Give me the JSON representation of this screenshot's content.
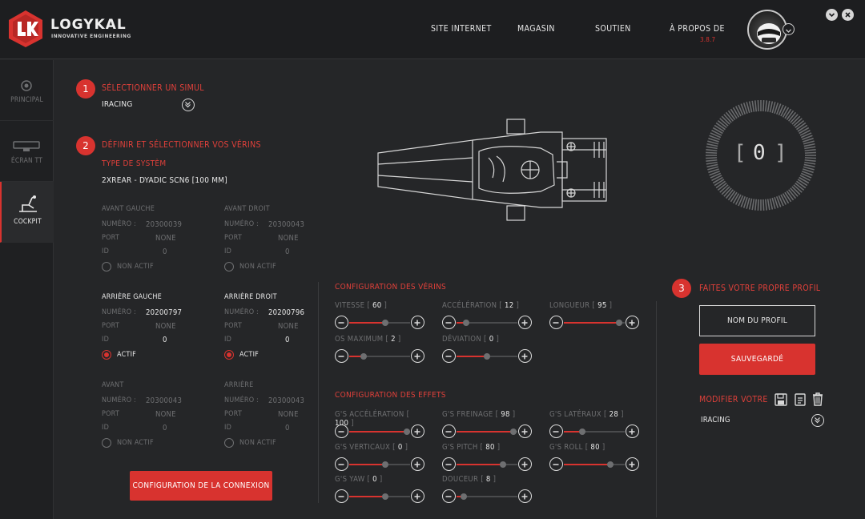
{
  "header": {
    "brand": "LOGYKAL",
    "tagline": "INNOVATIVE ENGINEERING",
    "nav": [
      "SITE INTERNET",
      "MAGASIN",
      "SOUTIEN",
      "À PROPOS DE"
    ],
    "version": "3.8.7"
  },
  "sidebar": {
    "items": [
      {
        "label": "PRINCIPAL",
        "icon": "target-icon"
      },
      {
        "label": "ÉCRAN TT",
        "icon": "display-icon"
      },
      {
        "label": "COCKPIT",
        "icon": "cockpit-seat-icon"
      }
    ]
  },
  "step1": {
    "num": "1",
    "title": "SÉLECTIONNER UN SIMUL",
    "value": "IRACING"
  },
  "step2": {
    "num": "2",
    "title": "DÉFINIR ET SÉLECTIONNER VOS VÉRINS",
    "system_label": "TYPE DE SYSTÈM",
    "system_value": "2XREAR - DYADIC SCN6 [100 MM]"
  },
  "fields": {
    "numero": "NUMÉRO :",
    "port": "PORT",
    "id": "ID"
  },
  "actuators": [
    {
      "name": "AVANT GAUCHE",
      "numero": "20300039",
      "port": "NONE",
      "id": "0",
      "status": "NON ACTIF"
    },
    {
      "name": "AVANT DROIT",
      "numero": "20300043",
      "port": "NONE",
      "id": "0",
      "status": "NON ACTIF"
    },
    {
      "name": "ARRIÈRE GAUCHE",
      "numero": "20200797",
      "port": "NONE",
      "id": "0",
      "status": "ACTIF"
    },
    {
      "name": "ARRIÈRE DROIT",
      "numero": "20200796",
      "port": "NONE",
      "id": "0",
      "status": "ACTIF"
    },
    {
      "name": "AVANT",
      "numero": "20300043",
      "port": "NONE",
      "id": "0",
      "status": "NON ACTIF"
    },
    {
      "name": "ARRIÈRE",
      "numero": "20300043",
      "port": "NONE",
      "id": "0",
      "status": "NON ACTIF"
    }
  ],
  "connection_button": "CONFIGURATION DE LA CONNEXION",
  "gauge": {
    "value": "0",
    "bracket_left": "[",
    "bracket_right": "]"
  },
  "verins": {
    "title": "CONFIGURATION DES VÉRINS",
    "sliders": [
      {
        "label": "VITESSE",
        "value": "60",
        "level": 0.6
      },
      {
        "label": "ACCÉLÉRATION",
        "value": "12",
        "level": 0.12
      },
      {
        "label": "LONGUEUR",
        "value": "95",
        "level": 0.95
      },
      {
        "label": "OS MAXIMUM",
        "value": "2",
        "level": 0.2
      },
      {
        "label": "DÉVIATION",
        "value": "0",
        "level": 0.5
      }
    ]
  },
  "effets": {
    "title": "CONFIGURATION DES EFFETS",
    "sliders": [
      {
        "label": "G'S ACCÉLÉRATION",
        "value": "100",
        "level": 1.0
      },
      {
        "label": "G'S FREINAGE",
        "value": "98",
        "level": 0.98
      },
      {
        "label": "G'S LATÉRAUX",
        "value": "28",
        "level": 0.28
      },
      {
        "label": "G'S VERTICAUX",
        "value": "0",
        "level": 0.6
      },
      {
        "label": "G'S PITCH",
        "value": "80",
        "level": 0.8
      },
      {
        "label": "G'S ROLL",
        "value": "80",
        "level": 0.8
      },
      {
        "label": "G'S YAW",
        "value": "0",
        "level": 0.6
      },
      {
        "label": "DOUCEUR",
        "value": "8",
        "level": 0.08
      }
    ]
  },
  "step3": {
    "num": "3",
    "title": "FAITES VOTRE PROPRE PROFIL",
    "input_placeholder": "NOM DU PROFIL",
    "save_button": "SAUVEGARDÉ",
    "modify_label": "MODIFIER VOTRE",
    "profile_value": "IRACING"
  },
  "colors": {
    "accent": "#d8332f",
    "background": "#252628",
    "header": "#1d1e20"
  }
}
